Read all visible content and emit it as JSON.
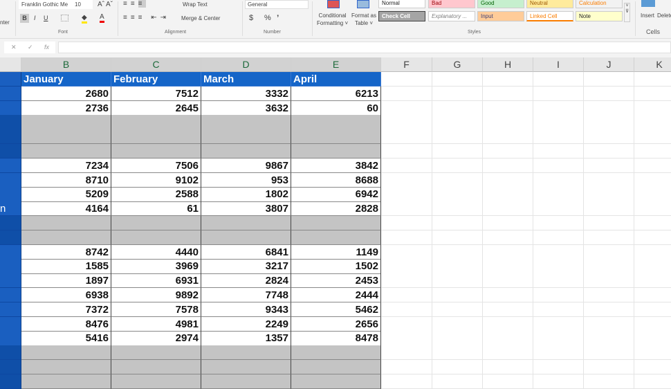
{
  "ribbon": {
    "clipped_left": "nter",
    "font_name": "Franklin Gothic Me",
    "font_size": "10",
    "grow": "Aˆ",
    "shrink": "Aˇ",
    "bold": "B",
    "italic": "I",
    "underline": "U",
    "font_group": "Font",
    "wrap_text": "Wrap Text",
    "merge_center": "Merge & Center",
    "alignment_group": "Alignment",
    "number_format": "General",
    "currency": "$",
    "percent": "%",
    "comma": "ʼ",
    "number_group": "Number",
    "conditional_formatting": [
      "Conditional",
      "Formatting ˅"
    ],
    "format_as_table": [
      "Format as",
      "Table ˅"
    ],
    "styles": [
      {
        "label": "Normal",
        "bg": "#ffffff",
        "fg": "#222222"
      },
      {
        "label": "Bad",
        "bg": "#ffc7ce",
        "fg": "#9c0006"
      },
      {
        "label": "Good",
        "bg": "#c6efce",
        "fg": "#006100"
      },
      {
        "label": "Neutral",
        "bg": "#ffeb9c",
        "fg": "#9c5700"
      },
      {
        "label": "Calculation",
        "bg": "#f2f2f2",
        "fg": "#fa7d00"
      },
      {
        "label": "Check Cell",
        "bg": "#a5a5a5",
        "fg": "#ffffff"
      },
      {
        "label": "Explanatory ...",
        "bg": "#ffffff",
        "fg": "#7f7f7f"
      },
      {
        "label": "Input",
        "bg": "#ffcc99",
        "fg": "#3f3f76"
      },
      {
        "label": "Linked Cell",
        "bg": "#ffffff",
        "fg": "#fa7d00"
      },
      {
        "label": "Note",
        "bg": "#ffffcc",
        "fg": "#222222"
      }
    ],
    "styles_group": "Styles",
    "insert": "Insert",
    "delete": "Delete",
    "cells_group": "Cells"
  },
  "formula_bar": {
    "cancel": "✕",
    "enter": "✓",
    "fx": "fx",
    "value": ""
  },
  "columns": [
    "B",
    "C",
    "D",
    "E",
    "F",
    "G",
    "H",
    "I",
    "J",
    "K"
  ],
  "table": {
    "headers": [
      "January",
      "February",
      "March",
      "April"
    ],
    "rows": [
      {
        "a": "",
        "v": [
          2680,
          7512,
          3332,
          6213
        ]
      },
      {
        "a": "",
        "v": [
          2736,
          2645,
          3632,
          60
        ]
      },
      {
        "a": "",
        "v": null
      },
      {
        "a": "",
        "v": null
      },
      {
        "a": "",
        "v": null
      },
      {
        "a": "",
        "v": [
          7234,
          7506,
          9867,
          3842
        ]
      },
      {
        "a": "",
        "v": [
          8710,
          9102,
          953,
          8688
        ]
      },
      {
        "a": "",
        "v": [
          5209,
          2588,
          1802,
          6942
        ]
      },
      {
        "a": "n",
        "v": [
          4164,
          61,
          3807,
          2828
        ]
      },
      {
        "a": "",
        "v": null
      },
      {
        "a": "",
        "v": null
      },
      {
        "a": "",
        "v": [
          8742,
          4440,
          6841,
          1149
        ]
      },
      {
        "a": "",
        "v": [
          1585,
          3969,
          3217,
          1502
        ]
      },
      {
        "a": "",
        "v": [
          1897,
          6931,
          2824,
          2453
        ]
      },
      {
        "a": "",
        "v": [
          6938,
          9892,
          7748,
          2444
        ]
      },
      {
        "a": "",
        "v": [
          7372,
          7578,
          9343,
          5462
        ]
      },
      {
        "a": "",
        "v": [
          8476,
          4981,
          2249,
          2656
        ]
      },
      {
        "a": "",
        "v": [
          5416,
          2974,
          1357,
          8478
        ]
      },
      {
        "a": "",
        "v": null
      },
      {
        "a": "",
        "v": null
      },
      {
        "a": "",
        "v": null
      }
    ]
  }
}
